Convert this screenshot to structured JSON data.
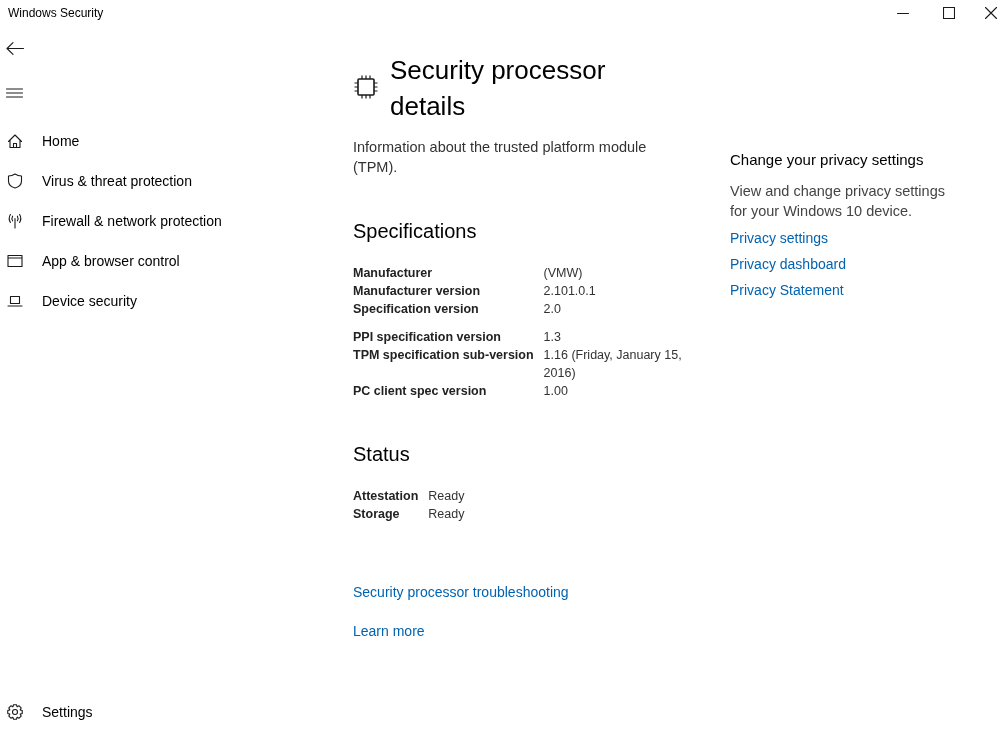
{
  "window": {
    "title": "Windows Security"
  },
  "sidebar": {
    "items": [
      "Home",
      "Virus & threat protection",
      "Firewall & network protection",
      "App & browser control",
      "Device security"
    ],
    "footer_items": [
      "Settings"
    ]
  },
  "page": {
    "title": "Security processor details",
    "description": "Information about the trusted platform module (TPM).",
    "sections": [
      {
        "heading": "Specifications",
        "groups": [
          [
            {
              "label": "Manufacturer",
              "value": "(VMW)"
            },
            {
              "label": "Manufacturer version",
              "value": "2.101.0.1"
            },
            {
              "label": "Specification version",
              "value": "2.0"
            }
          ],
          [
            {
              "label": "PPI specification version",
              "value": "1.3"
            },
            {
              "label": "TPM specification sub-version",
              "value": "1.16 (Friday, January 15, 2016)"
            },
            {
              "label": "PC client spec version",
              "value": "1.00"
            }
          ]
        ]
      },
      {
        "heading": "Status",
        "groups": [
          [
            {
              "label": "Attestation",
              "value": "Ready"
            },
            {
              "label": "Storage",
              "value": "Ready"
            }
          ]
        ]
      }
    ],
    "links": [
      "Security processor troubleshooting",
      "Learn more"
    ]
  },
  "privacy_panel": {
    "heading": "Change your privacy settings",
    "description": "View and change privacy settings for your Windows 10 device.",
    "links": [
      "Privacy settings",
      "Privacy dashboard",
      "Privacy Statement"
    ]
  }
}
